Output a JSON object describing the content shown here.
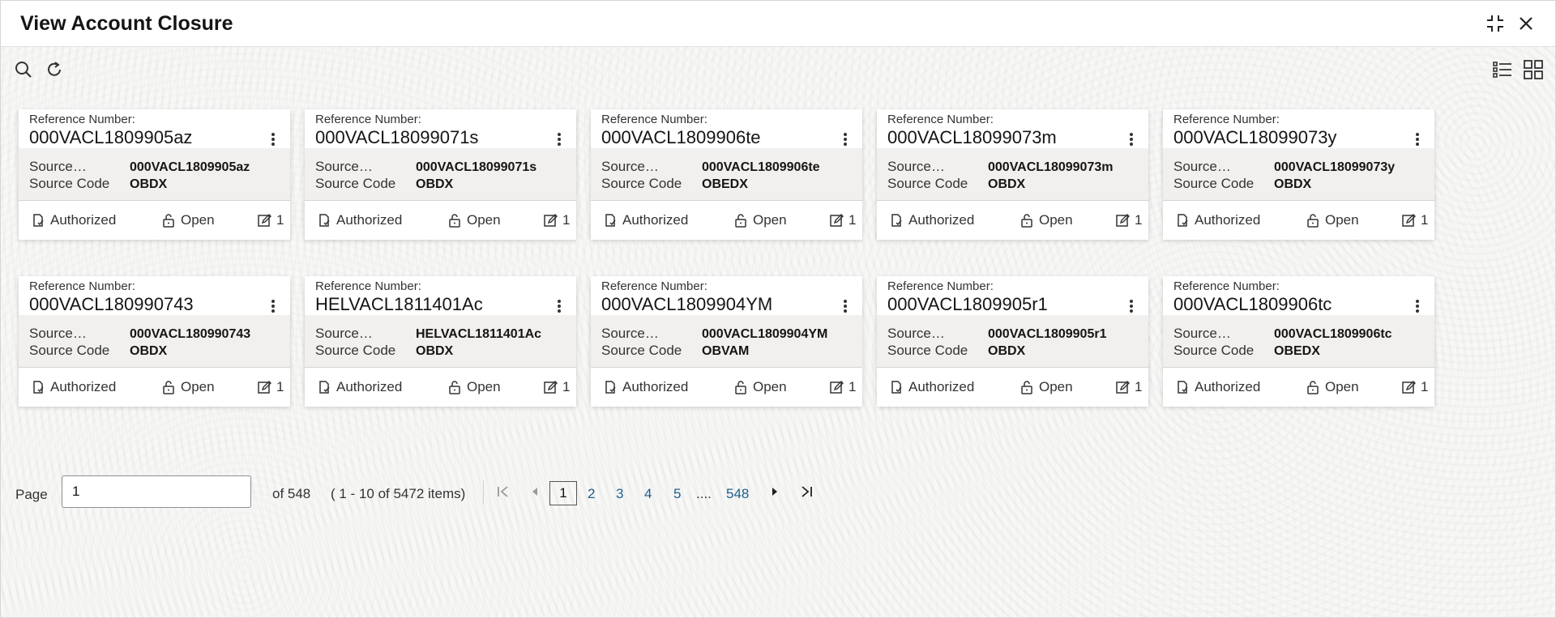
{
  "window": {
    "title": "View Account Closure"
  },
  "header_icons": [
    "collapse-icon",
    "close-icon"
  ],
  "toolbar": {
    "icons": [
      "search-icon",
      "refresh-icon",
      "list-view-icon",
      "grid-view-icon"
    ]
  },
  "card_labels": {
    "ref_label": "Reference Number:",
    "source_label": "Source…",
    "source_code_label": "Source Code"
  },
  "cards": [
    {
      "ref": "000VACL1809905az",
      "source": "000VACL1809905az",
      "code": "OBDX",
      "auth": "Authorized",
      "status": "Open",
      "count": "1"
    },
    {
      "ref": "000VACL18099071s",
      "source": "000VACL18099071s",
      "code": "OBDX",
      "auth": "Authorized",
      "status": "Open",
      "count": "1"
    },
    {
      "ref": "000VACL1809906te",
      "source": "000VACL1809906te",
      "code": "OBEDX",
      "auth": "Authorized",
      "status": "Open",
      "count": "1"
    },
    {
      "ref": "000VACL18099073m",
      "source": "000VACL18099073m",
      "code": "OBDX",
      "auth": "Authorized",
      "status": "Open",
      "count": "1"
    },
    {
      "ref": "000VACL18099073y",
      "source": "000VACL18099073y",
      "code": "OBDX",
      "auth": "Authorized",
      "status": "Open",
      "count": "1"
    },
    {
      "ref": "000VACL180990743",
      "source": "000VACL180990743",
      "code": "OBDX",
      "auth": "Authorized",
      "status": "Open",
      "count": "1"
    },
    {
      "ref": "HELVACL1811401Ac",
      "source": "HELVACL1811401Ac",
      "code": "OBDX",
      "auth": "Authorized",
      "status": "Open",
      "count": "1"
    },
    {
      "ref": "000VACL1809904YM",
      "source": "000VACL1809904YM",
      "code": "OBVAM",
      "auth": "Authorized",
      "status": "Open",
      "count": "1"
    },
    {
      "ref": "000VACL1809905r1",
      "source": "000VACL1809905r1",
      "code": "OBDX",
      "auth": "Authorized",
      "status": "Open",
      "count": "1"
    },
    {
      "ref": "000VACL1809906tc",
      "source": "000VACL1809906tc",
      "code": "OBEDX",
      "auth": "Authorized",
      "status": "Open",
      "count": "1"
    }
  ],
  "pagination": {
    "page_label": "Page",
    "page_value": "1",
    "of_text": "of 548",
    "items_text": "( 1 - 10 of 5472 items)",
    "current": "1",
    "pages": [
      "2",
      "3",
      "4",
      "5"
    ],
    "ellipsis": "....",
    "last": "548"
  }
}
